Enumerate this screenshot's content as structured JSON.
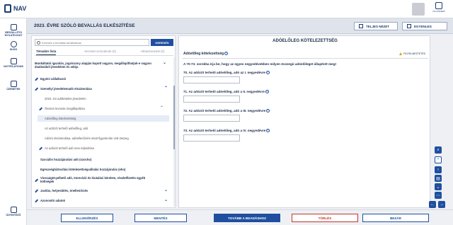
{
  "app": {
    "logo_text": "NAV",
    "top_right_label": "ÜGYINTÉZŐ"
  },
  "nav": [
    {
      "label": "BESZÁLLÍTÓI NYILATKOZAT"
    },
    {
      "label": "SÚGÓ"
    },
    {
      "label": "NOTIFICATIONS"
    },
    {
      "label": "ÜZENETEK"
    },
    {
      "label": "ÜGYINTÉZŐ"
    }
  ],
  "header": {
    "title": "2023. ÉVRE SZÓLÓ BEVALLÁS ELKÉSZÍTÉSE",
    "full_view_label": "TELJES NÉZET",
    "split_label": "EGYENLEG"
  },
  "search": {
    "placeholder": "Keresés a bevallás tartalmában",
    "button_label": "KERESÉS"
  },
  "tabs": [
    {
      "label": "Témakör lista"
    },
    {
      "label": "Vezetett sorszámok (0)"
    },
    {
      "label": "Hibaüzenetek (0)"
    }
  ],
  "list": [
    {
      "text": "Munkáltatói igazolás, jogviszony alapján kapott vagyon, megállapíthatjuk-e vagyon átadásából jövedelem és adója"
    },
    {
      "text": "Egyéni vállalkozói"
    },
    {
      "text": "Személyi jövedelemadó elszámolása"
    },
    {
      "text": "2023. évi adóköteles jövedelem"
    },
    {
      "text": "Összes levonás megállapítása"
    },
    {
      "text": "Adóelőleg kötelezettség"
    },
    {
      "text": "Az adózót terhelő adóelőleg, adó"
    },
    {
      "text": "Adózó elszámolása, adóellenőrzés miatt figyelembe vett összeg"
    },
    {
      "text": "Az adózót terhelő adó nem teljesítése"
    },
    {
      "text": "Szociális hozzájárulási adó (szocho)"
    },
    {
      "text": "Egészségbiztosítási kötelezettségvállalás hozzájárulás (eho)"
    },
    {
      "text": "Visszaigényelhető adó, önrevízió és kiutalási kérelem, részletfizetés egyéb költségek"
    },
    {
      "text": "Javítás, helyesbítés, önellenőrzés"
    },
    {
      "text": "Azonosító adatok"
    }
  ],
  "right": {
    "title": "ADÓELŐLEG KÖTELEZETTSÉG",
    "section": "Adóelőleg kötelezettség",
    "warning": "FIGYELMEZTETÉS",
    "intro": "A 70-73. sorokba írja be, hogy az egyes negyedévekben milyen összegű adóelőleget állapított meg!",
    "questions": [
      {
        "label": "70. Az adózót terhelő adóelőleg, adó az I. negyedévre",
        "value": ""
      },
      {
        "label": "71. Az adózót terhelő adóelőleg, adó a II. negyedévre",
        "value": ""
      },
      {
        "label": "72. Az adózót terhelő adóelőleg, adó a III. negyedévre",
        "value": ""
      },
      {
        "label": "73. Az adózót terhelő adóelőleg, adó a IV. negyedévre",
        "value": ""
      }
    ]
  },
  "footer": {
    "check_label": "ELLENŐRZÉS",
    "save_label": "MENTÉS",
    "submit_label": "TOVÁBB A BEADÁSHOZ",
    "delete_label": "TÖRLÉS",
    "close_label": "BEZÁR"
  }
}
